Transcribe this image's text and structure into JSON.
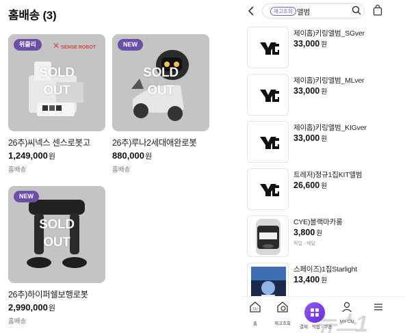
{
  "left": {
    "title": "홈배송 (3)",
    "cards": [
      {
        "badge": "위클리",
        "overlay_line1": "SOLD",
        "overlay_line2": "OUT",
        "name": "26추)씨넥스 센스로봇고",
        "price": "1,249,000",
        "currency": "원",
        "shipping": "홈배송",
        "brand_mark": "SENSE ROBOT"
      },
      {
        "badge": "NEW",
        "overlay_line1": "SOLD",
        "overlay_line2": "OUT",
        "name": "26추)루나2세대애완로봇",
        "price": "880,000",
        "currency": "원",
        "shipping": "홈배송"
      },
      {
        "badge": "NEW",
        "overlay_line1": "SOLD",
        "overlay_line2": "OUT",
        "name": "26추)하이퍼쉘보행로봇",
        "price": "2,990,000",
        "currency": "원",
        "shipping": "홈배송"
      }
    ]
  },
  "right": {
    "search": {
      "chip": "재고조회",
      "query": "앨범"
    },
    "results": [
      {
        "name": "제이홉)키링앨범_SGver",
        "price": "33,000",
        "currency": "원",
        "thumb": "yg-logo"
      },
      {
        "name": "제이홉)키링앨범_MLver",
        "price": "33,000",
        "currency": "원",
        "thumb": "yg-logo"
      },
      {
        "name": "제이홉)키링앨범_KIGver",
        "price": "33,000",
        "currency": "원",
        "thumb": "yg-logo"
      },
      {
        "name": "트레저)정규1집KIT앨범",
        "price": "26,600",
        "currency": "원",
        "thumb": "yg-logo"
      },
      {
        "name": "CYE)블랙마카롱",
        "price": "3,800",
        "currency": "원",
        "shipping": "픽업 · 배달",
        "thumb": "macaron-pack"
      },
      {
        "name": "스페이즈)1집Starlight",
        "price": "13,400",
        "currency": "원",
        "thumb": "album-cover"
      }
    ],
    "nav": [
      {
        "label": "홈",
        "icon": "home-icon"
      },
      {
        "label": "재고조회",
        "icon": "stock-search-icon"
      },
      {
        "label": "결제 · 적립 · 쿠폰",
        "icon": "pay-icon"
      },
      {
        "label": "MY CU",
        "icon": "my-cu-icon"
      },
      {
        "label": "",
        "icon": "menu-icon"
      }
    ],
    "watermark": "뉴스1"
  },
  "colors": {
    "accent": "#6b4ea8",
    "chip": "#7d5cc7",
    "sold_overlay": "#bdbdbd"
  }
}
